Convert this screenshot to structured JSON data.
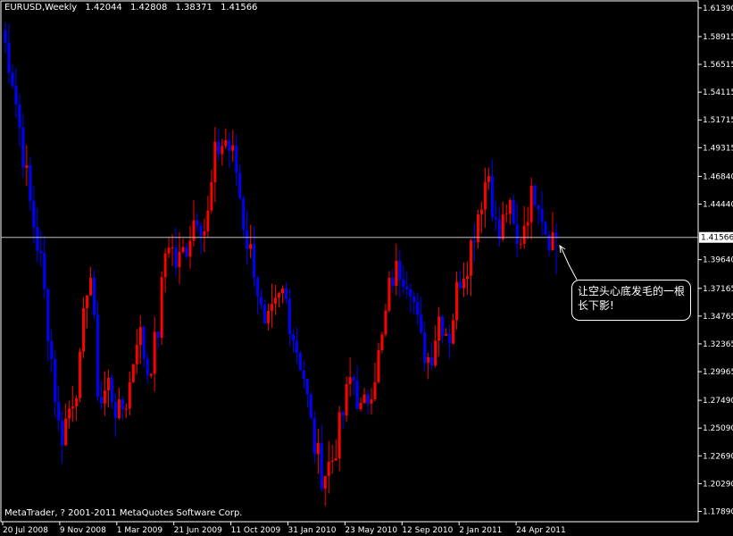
{
  "chart": {
    "symbol": "EURUSD,Weekly",
    "open": "1.42044",
    "high": "1.42808",
    "low": "1.38371",
    "close": "1.41566",
    "current_price_label": "1.41566",
    "copyright": "MetaTrader, ? 2001-2011 MetaQuotes Software Corp.",
    "annotation_line1": "让空头心底发毛的一根",
    "annotation_line2": "长下影!"
  },
  "colors": {
    "background": "#000000",
    "bull_candle": "#ff0000",
    "bear_candle": "#0000ff",
    "axis": "#ffffff",
    "price_line": "#c0c0c0",
    "current_price_box_bg": "#ffffff",
    "current_price_box_fg": "#000000"
  },
  "chart_data": {
    "type": "candlestick",
    "price_axis": {
      "min": 1.17,
      "max": 1.62,
      "ticks": [
        "1.61390",
        "1.58915",
        "1.56515",
        "1.54115",
        "1.51715",
        "1.49315",
        "1.46840",
        "1.44440",
        "1.41566",
        "1.39640",
        "1.37165",
        "1.34765",
        "1.32365",
        "1.29965",
        "1.27490",
        "1.25090",
        "1.22690",
        "1.20290",
        "1.17890"
      ]
    },
    "time_axis": {
      "labels": [
        "20 Jul 2008",
        "9 Nov 2008",
        "1 Mar 2009",
        "21 Jun 2009",
        "11 Oct 2009",
        "31 Jan 2010",
        "23 May 2010",
        "12 Sep 2010",
        "2 Jan 2011",
        "24 Apr 2011"
      ]
    },
    "current_price": 1.41566,
    "path": [
      1.595,
      1.56,
      1.5,
      1.44,
      1.395,
      1.32,
      1.24,
      1.27,
      1.3,
      1.4,
      1.27,
      1.29,
      1.26,
      1.28,
      1.34,
      1.3,
      1.33,
      1.42,
      1.39,
      1.41,
      1.44,
      1.42,
      1.49,
      1.5,
      1.48,
      1.42,
      1.39,
      1.33,
      1.35,
      1.37,
      1.33,
      1.3,
      1.24,
      1.21,
      1.225,
      1.26,
      1.3,
      1.26,
      1.29,
      1.32,
      1.38,
      1.39,
      1.38,
      1.325,
      1.31,
      1.35,
      1.33,
      1.38,
      1.4,
      1.44,
      1.475,
      1.41,
      1.445,
      1.405,
      1.44,
      1.46,
      1.42,
      1.415
    ],
    "bars": 156
  }
}
